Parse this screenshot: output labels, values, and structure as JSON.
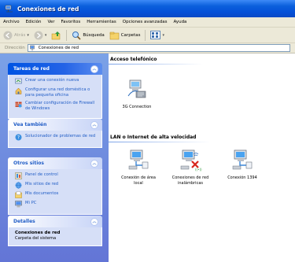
{
  "window": {
    "title": "Conexiones de red",
    "icon": "network-connections-icon"
  },
  "menu": [
    "Archivo",
    "Edición",
    "Ver",
    "Favoritos",
    "Herramientas",
    "Opciones avanzadas",
    "Ayuda"
  ],
  "toolbar": {
    "back_label": "Atrás",
    "search_label": "Búsqueda",
    "folders_label": "Carpetas"
  },
  "address": {
    "label": "Dirección",
    "value": "Conexiones de red"
  },
  "sidebar": {
    "tasks": {
      "title": "Tareas de red",
      "items": [
        {
          "label": "Crear una conexión nueva",
          "icon": "new-connection-icon"
        },
        {
          "label": "Configurar una red doméstica o para pequeña oficina",
          "icon": "home-network-icon"
        },
        {
          "label": "Cambiar configuración de Firewall de Windows",
          "icon": "firewall-icon"
        }
      ]
    },
    "see_also": {
      "title": "Vea también",
      "items": [
        {
          "label": "Solucionador de problemas de red",
          "icon": "troubleshooter-icon"
        }
      ]
    },
    "other_places": {
      "title": "Otros sitios",
      "items": [
        {
          "label": "Panel de control",
          "icon": "control-panel-icon"
        },
        {
          "label": "Mis sitios de red",
          "icon": "network-places-icon"
        },
        {
          "label": "Mis documentos",
          "icon": "my-documents-icon"
        },
        {
          "label": "Mi PC",
          "icon": "my-computer-icon"
        }
      ]
    },
    "details": {
      "title": "Detalles",
      "name": "Conexiones de red",
      "description": "Carpeta del sistema"
    }
  },
  "content": {
    "groups": [
      {
        "title": "Acceso telefónico",
        "items": [
          {
            "label": "3G Connection",
            "icon": "dialup-connection-icon"
          }
        ]
      },
      {
        "title": "LAN o Internet de alta velocidad",
        "items": [
          {
            "label": "Conexión de área local",
            "icon": "lan-connection-icon"
          },
          {
            "label": "Conexiones de red inalámbricas",
            "icon": "wireless-connection-disabled-icon"
          },
          {
            "label": "Conexión 1394",
            "icon": "firewire-connection-icon"
          }
        ]
      }
    ]
  },
  "colors": {
    "titlebar": "#0a5fdc",
    "sidebar": "#6f8ddc",
    "link": "#215dc6"
  }
}
